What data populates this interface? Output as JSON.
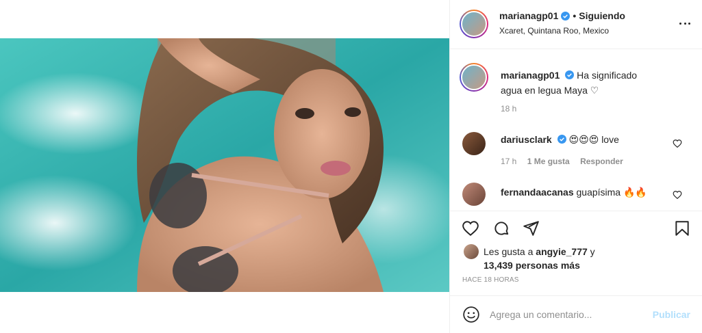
{
  "post": {
    "author": "marianagp01",
    "follow_status": "Siguiendo",
    "separator": "•",
    "location": "Xcaret, Quintana Roo, Mexico"
  },
  "caption": {
    "username": "marianagp01",
    "text": "Ha significado agua en legua Maya",
    "emoji": "♡",
    "time": "18 h"
  },
  "comments": [
    {
      "username": "dariusclark",
      "text": "love",
      "emoji": "😍😍😍",
      "time": "17 h",
      "likes": "1 Me gusta",
      "reply": "Responder"
    },
    {
      "username": "fernandaacanas",
      "text": "guapísima",
      "emoji": "🔥🔥"
    }
  ],
  "likes": {
    "prefix": "Les gusta a",
    "first_user": "angyie_777",
    "conj": "y",
    "count": "13,439 personas más"
  },
  "timestamp": "HACE 18 HORAS",
  "add_comment": {
    "placeholder": "Agrega un comentario...",
    "publish_label": "Publicar"
  },
  "icons": {
    "like": "heart-icon",
    "comment": "comment-icon",
    "share": "share-icon",
    "save": "bookmark-icon",
    "verified": "verified-badge-icon",
    "emoji": "smiley-icon",
    "more": "more-options-icon"
  },
  "colors": {
    "verified": "#3897f0",
    "muted": "#8e8e8e",
    "publish": "#b2dffc",
    "border": "#efefef"
  }
}
